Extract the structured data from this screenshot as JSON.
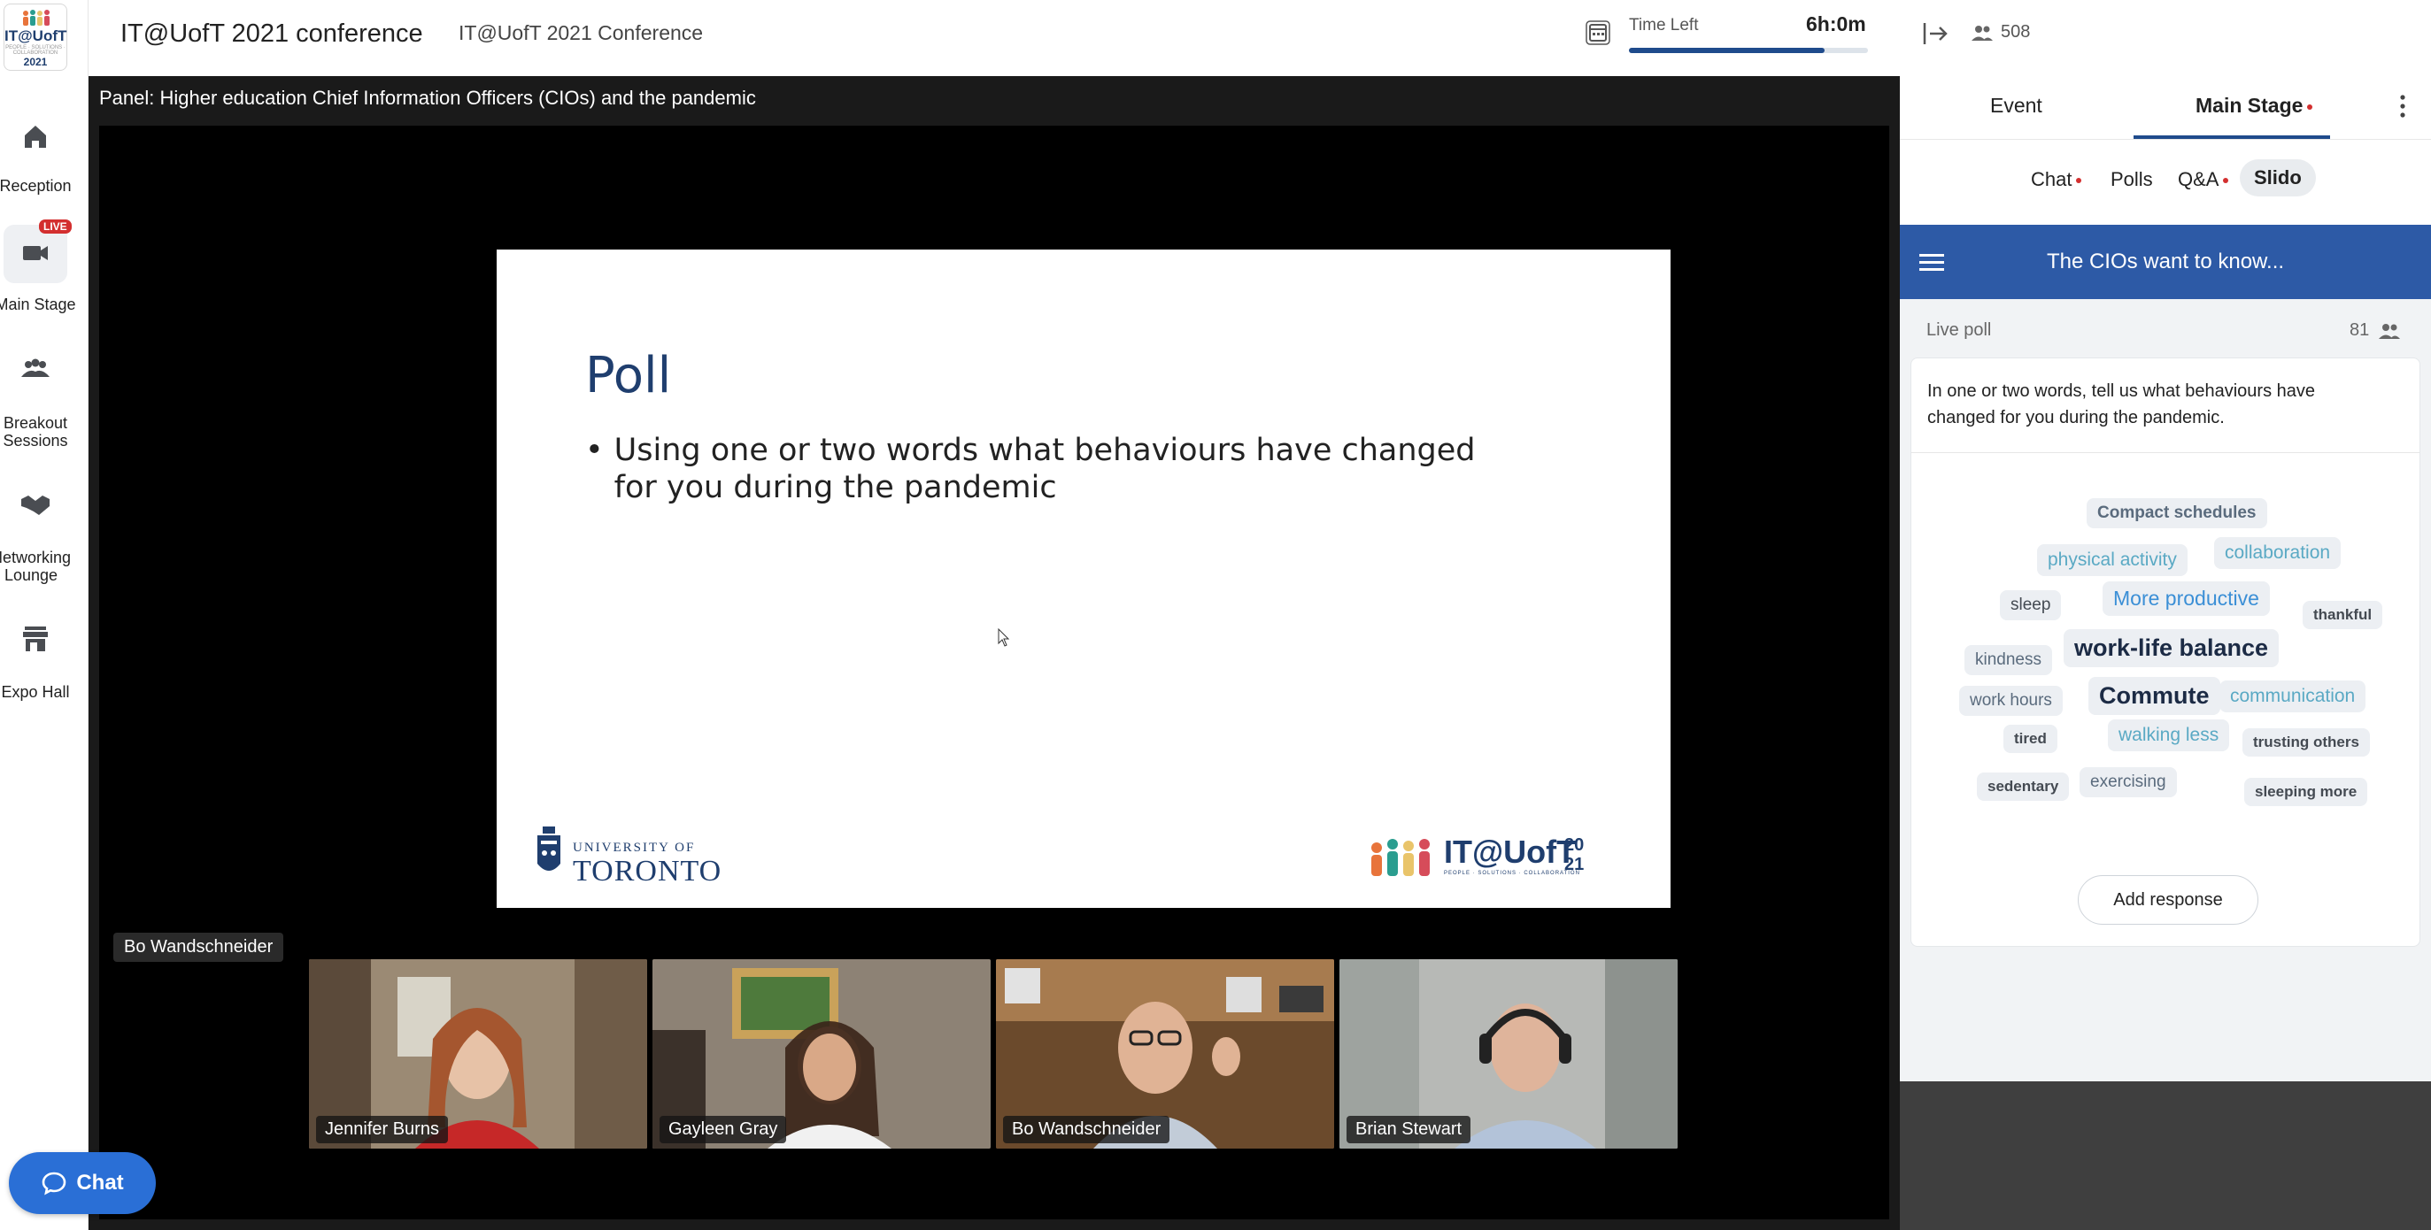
{
  "logo": {
    "text": "IT@UofT",
    "tagline": "PEOPLE · SOLUTIONS · COLLABORATION",
    "year": "2021"
  },
  "nav": {
    "items": [
      {
        "label": "Reception",
        "icon": "home-icon"
      },
      {
        "label": "Main Stage",
        "icon": "video-camera-icon",
        "badge": "LIVE",
        "active": true
      },
      {
        "label": "Breakout Sessions",
        "icon": "group-icon"
      },
      {
        "label": "Networking Lounge",
        "icon": "handshake-icon"
      },
      {
        "label": "Expo Hall",
        "icon": "storefront-icon"
      }
    ]
  },
  "chat_button": {
    "label": "Chat"
  },
  "header": {
    "title": "IT@UofT 2021 conference",
    "subtitle": "IT@UofT 2021 Conference",
    "time_left_label": "Time Left",
    "time_left_value": "6h:0m",
    "time_progress_pct": 82
  },
  "stage": {
    "panel_title": "Panel: Higher education Chief Information Officers (CIOs) and the pandemic",
    "active_speaker": "Bo Wandschneider",
    "slide": {
      "title": "Poll",
      "bullet": "Using one or two words what behaviours have changed for you during the pandemic",
      "uoft_line1": "UNIVERSITY OF",
      "uoft_line2": "TORONTO",
      "ituoft_text": "IT@UofT",
      "ituoft_year_top": "20",
      "ituoft_year_bottom": "21",
      "ituoft_tagline": "PEOPLE · SOLUTIONS · COLLABORATION"
    },
    "participants": [
      {
        "name": "Jennifer Burns",
        "bg": "#8a7560"
      },
      {
        "name": "Gayleen Gray",
        "bg": "#6d5f52"
      },
      {
        "name": "Bo Wandschneider",
        "bg": "#7a5a3c"
      },
      {
        "name": "Brian Stewart",
        "bg": "#a5a8a6"
      }
    ]
  },
  "right_panel": {
    "attendee_count": "508",
    "tabs": [
      {
        "label": "Event"
      },
      {
        "label": "Main Stage",
        "active": true,
        "dot": true
      }
    ],
    "sub_tabs": [
      {
        "label": "Chat",
        "dot": true
      },
      {
        "label": "Polls"
      },
      {
        "label": "Q&A",
        "dot": true
      },
      {
        "label": "Slido",
        "active": true
      }
    ],
    "slido": {
      "title": "The CIOs want to know...",
      "live_poll_label": "Live poll",
      "participant_count": "81",
      "question": "In one or two words, tell us what behaviours have changed for you during the pandemic.",
      "add_response": "Add response",
      "words": [
        {
          "text": "Compact schedules",
          "color": "#5a6b7d"
        },
        {
          "text": "physical activity",
          "color": "#5aa9c4"
        },
        {
          "text": "collaboration",
          "color": "#5aa9c4"
        },
        {
          "text": "sleep",
          "color": "#444a52"
        },
        {
          "text": "More productive",
          "color": "#3b8fd6"
        },
        {
          "text": "thankful",
          "color": "#444a52"
        },
        {
          "text": "kindness",
          "color": "#5a6b7d"
        },
        {
          "text": "work-life balance",
          "color": "#1c2b45"
        },
        {
          "text": "work hours",
          "color": "#5a6b7d"
        },
        {
          "text": "Commute",
          "color": "#1c2b45"
        },
        {
          "text": "communication",
          "color": "#5aa9c4"
        },
        {
          "text": "tired",
          "color": "#444a52"
        },
        {
          "text": "walking less",
          "color": "#5aa9c4"
        },
        {
          "text": "trusting others",
          "color": "#444a52"
        },
        {
          "text": "sedentary",
          "color": "#444a52"
        },
        {
          "text": "exercising",
          "color": "#5a6b7d"
        },
        {
          "text": "sleeping more",
          "color": "#444a52"
        }
      ]
    }
  }
}
